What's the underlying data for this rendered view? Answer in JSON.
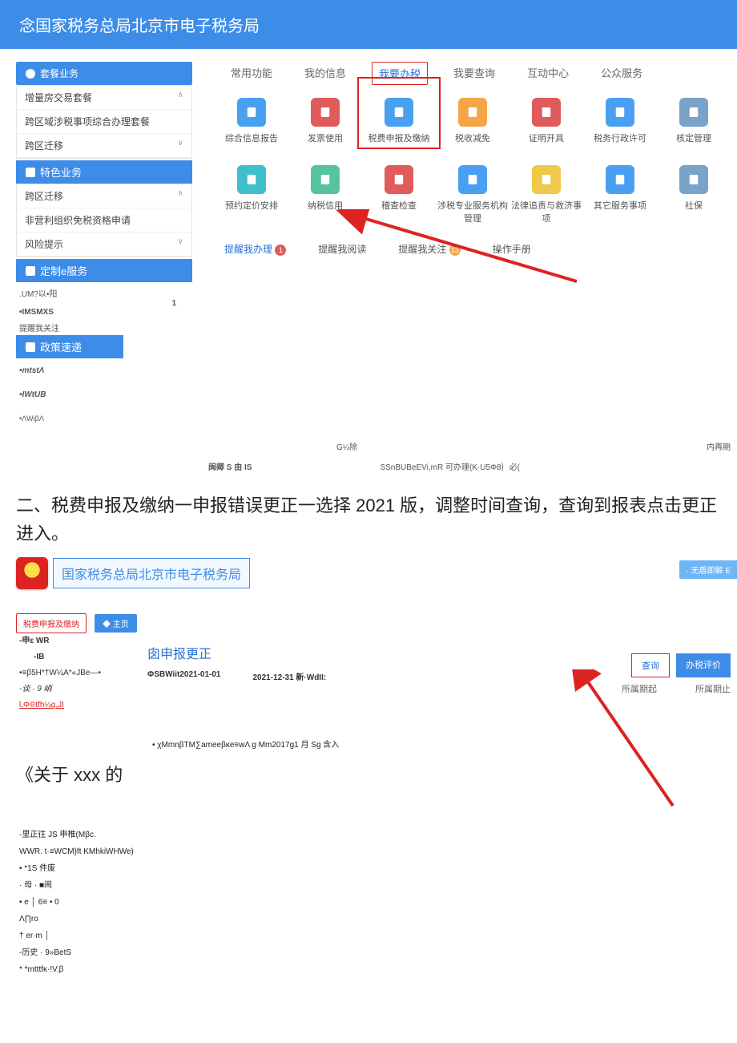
{
  "header": {
    "title": "念国家税务总局北京市电子税务局"
  },
  "sidebar": {
    "groups": [
      {
        "title": "套餐业务",
        "icon": "dot",
        "items": [
          "增量房交易套餐",
          "跨区域涉税事项综合办理套餐",
          "跨区迁移"
        ]
      },
      {
        "title": "特色业务",
        "icon": "grid",
        "items": [
          "跨区迁移",
          "非营利组织免税资格申请",
          "风险提示"
        ]
      },
      {
        "title": "定制e服务",
        "icon": "person",
        "items": [
          ".UM?以•阳",
          "•IMSMXS",
          "提醒我关注"
        ]
      },
      {
        "title": "政策速递",
        "icon": "person",
        "items": [
          "•mtstΛ",
          "•IWtUB",
          "•ΛWiβΛ"
        ]
      }
    ],
    "pagenum": "1"
  },
  "nav_tabs": [
    "常用功能",
    "我的信息",
    "我要办税",
    "我要查询",
    "互动中心",
    "公众服务"
  ],
  "nav_active_index": 2,
  "icons_row1": [
    {
      "label": "综合信息报告",
      "cls": "ic-blue",
      "name": "card-report-icon"
    },
    {
      "label": "发票使用",
      "cls": "ic-red",
      "name": "invoice-icon"
    },
    {
      "label": "税费申报及缴纳",
      "cls": "ic-blue",
      "name": "tax-filing-icon",
      "highlight": true
    },
    {
      "label": "税收减免",
      "cls": "ic-orange",
      "name": "tax-reduction-icon"
    },
    {
      "label": "证明开具",
      "cls": "ic-red",
      "name": "certificate-icon"
    },
    {
      "label": "税务行政许可",
      "cls": "ic-blue",
      "name": "admin-permit-icon"
    },
    {
      "label": "核定管理",
      "cls": "ic-gray",
      "name": "approval-mgmt-icon"
    }
  ],
  "icons_row2": [
    {
      "label": "预约定价安排",
      "cls": "ic-teal",
      "name": "pricing-icon"
    },
    {
      "label": "纳税信用",
      "cls": "ic-green",
      "name": "credit-icon"
    },
    {
      "label": "稽查检查",
      "cls": "ic-red",
      "name": "audit-icon"
    },
    {
      "label": "涉税专业服务机构管理",
      "cls": "ic-blue",
      "name": "agency-mgmt-icon"
    },
    {
      "label": "法律追责与救济事项",
      "cls": "ic-yellow",
      "name": "legal-icon"
    },
    {
      "label": "其它服务事项",
      "cls": "ic-blue",
      "name": "other-service-icon"
    },
    {
      "label": "社保",
      "cls": "ic-gray",
      "name": "social-ins-icon"
    }
  ],
  "alerts": {
    "a": {
      "label": "提醒我办理",
      "count": "1"
    },
    "b": {
      "label": "提醒我阅读"
    },
    "c": {
      "label": "提醒我关注",
      "count": "13"
    },
    "d": {
      "label": "操作手册"
    }
  },
  "foot_labels": {
    "l1": "G¼除",
    "r1": "内再期",
    "l2": "闽卿 S 由 IS",
    "r2": "SSnBUBeEVi,mR 可办理(K·U5Φ8｝必("
  },
  "instruction": "二、税费申报及缴纳一申报错误更正一选择 2021 版，调整时间查询，查询到报表点击更正进入。",
  "shot2": {
    "title": "国家税务总局北京市电子税务局",
    "top_chip": "·  无盾即解 E",
    "breadcrumb_red": "税费申报及缴纳",
    "breadcrumb_blue": "◆ 主页",
    "form_title": "囱申报更正",
    "left": [
      "-申ε WR",
      "-IB",
      "•≡β5H*†W¼A*«JBe—•",
      "-谈 · 9 峭",
      "l,Φ®tfh¼q,JI"
    ],
    "mid_left": "ΦSBWiit2021-01-01",
    "mid_right": "2021-12-31 新·WdII:",
    "btn_query": "查询",
    "btn_eval": "办税评价",
    "col_start": "所属期起",
    "col_end": "所属期止",
    "note": "• χMmnβTM∑ameeβκe≡wΛ g Mm2017g1 月 Sg 含入",
    "bigquote": "《关于 xxx 的",
    "footnotes": [
      "-里正往 JS 申椎(Mβc.",
      "    WWR. t·≡WCM}ft KMhkiWHWe)",
      "• *1S 件废",
      "·        母 · ■闹",
      "• e │ 6≡             • 0",
      "   Λ∏ro",
      "† er·m │",
      "-历史  · 9»BetS",
      "* *mtttfκ·!V.β"
    ]
  }
}
